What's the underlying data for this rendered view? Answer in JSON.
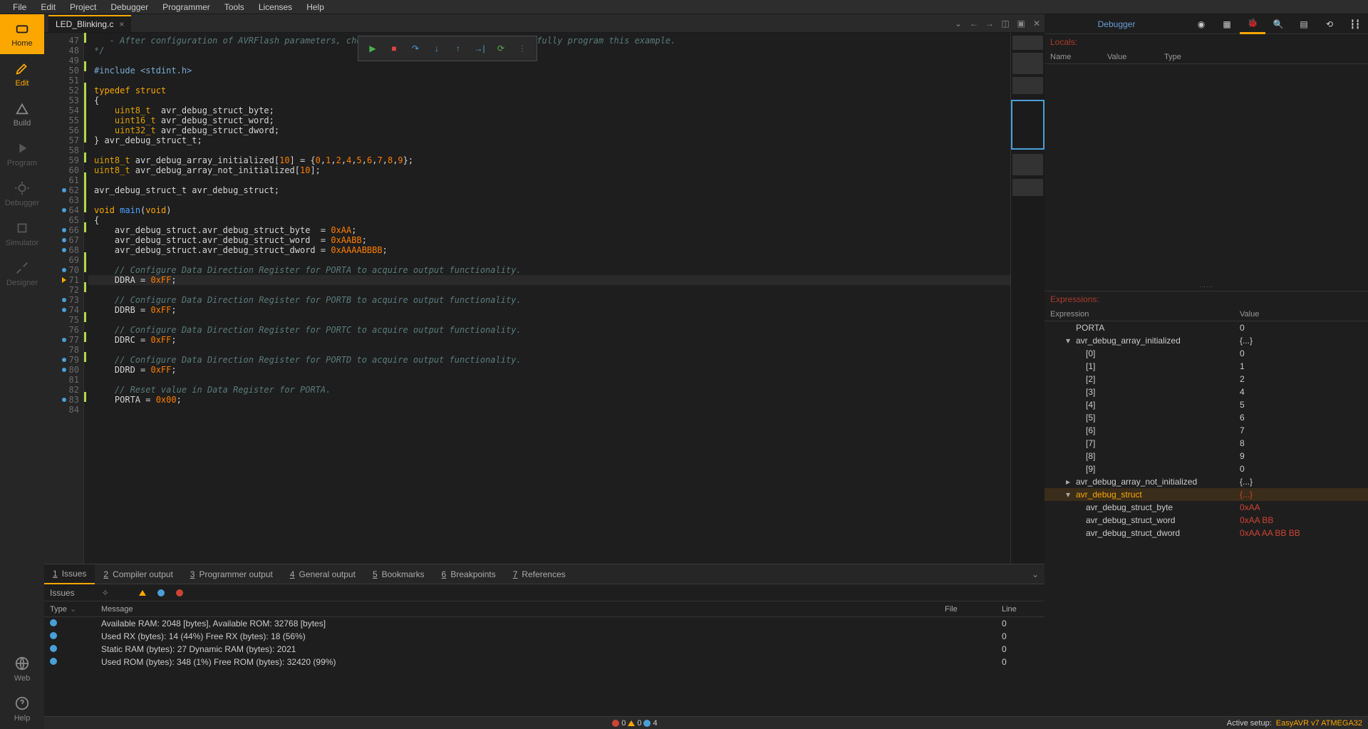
{
  "menu": [
    "File",
    "Edit",
    "Project",
    "Debugger",
    "Programmer",
    "Tools",
    "Licenses",
    "Help"
  ],
  "sidebar": [
    {
      "icon": "home",
      "label": "Home",
      "active": true
    },
    {
      "icon": "edit",
      "label": "Edit",
      "color": "orange"
    },
    {
      "icon": "build",
      "label": "Build"
    },
    {
      "icon": "run",
      "label": "Program",
      "disabled": true
    },
    {
      "icon": "bug",
      "label": "Debugger",
      "disabled": true
    },
    {
      "icon": "chip",
      "label": "Simulator",
      "disabled": true
    },
    {
      "icon": "design",
      "label": "Designer",
      "disabled": true
    }
  ],
  "sidebar_bottom": [
    {
      "icon": "web",
      "label": "Web"
    },
    {
      "icon": "help",
      "label": "Help"
    }
  ],
  "tab": {
    "name": "LED_Blinking.c"
  },
  "debug_tools": [
    "run",
    "stop",
    "step-over",
    "step-into",
    "step-out",
    "run-to",
    "restart",
    "grip"
  ],
  "code_lines": [
    {
      "n": 47,
      "html": "<span class='cmt'>   - After configuration of AVRFlash parameters, choose \"Write\" &nbsp;&nbsp;&nbsp;&nbsp;&nbsp;&nbsp;&nbsp;&nbsp;&nbsp;&nbsp;&nbsp;&nbsp;&nbsp;&nbsp;&nbsp;&nbsp;&nbsp;&nbsp;&nbsp;&nbsp;&nbsp;&nbsp;fully program this example.</span>",
      "mod": true
    },
    {
      "n": 48,
      "html": "<span class='cmt'>*/</span>",
      "mod": true
    },
    {
      "n": 49,
      "html": ""
    },
    {
      "n": 50,
      "html": "<span class='pre'>#include &lt;stdint.h&gt;</span>",
      "mod": true
    },
    {
      "n": 51,
      "html": ""
    },
    {
      "n": 52,
      "html": "<span class='kw'>typedef</span> <span class='kw'>struct</span>",
      "mod": true
    },
    {
      "n": 53,
      "html": "{",
      "mod": true
    },
    {
      "n": 54,
      "html": "    <span class='type'>uint8_t</span>  avr_debug_struct_byte;",
      "mod": true
    },
    {
      "n": 55,
      "html": "    <span class='type'>uint16_t</span> avr_debug_struct_word;",
      "mod": true
    },
    {
      "n": 56,
      "html": "    <span class='type'>uint32_t</span> avr_debug_struct_dword;",
      "mod": true
    },
    {
      "n": 57,
      "html": "} avr_debug_struct_t;",
      "mod": true
    },
    {
      "n": 58,
      "html": ""
    },
    {
      "n": 59,
      "html": "<span class='type'>uint8_t</span> avr_debug_array_initialized[<span class='num'>10</span>] = {<span class='num'>0</span>,<span class='num'>1</span>,<span class='num'>2</span>,<span class='num'>4</span>,<span class='num'>5</span>,<span class='num'>6</span>,<span class='num'>7</span>,<span class='num'>8</span>,<span class='num'>9</span>};",
      "mod": true
    },
    {
      "n": 60,
      "html": "<span class='type'>uint8_t</span> avr_debug_array_not_initialized[<span class='num'>10</span>];",
      "mod": true
    },
    {
      "n": 61,
      "html": ""
    },
    {
      "n": 62,
      "html": "avr_debug_struct_t avr_debug_struct;",
      "mod": true,
      "bp": true
    },
    {
      "n": 63,
      "html": ""
    },
    {
      "n": 64,
      "html": "<span class='kw'>void</span> <span class='func'>main</span>(<span class='kw'>void</span>)",
      "mod": true,
      "bp": true
    },
    {
      "n": 65,
      "html": "{"
    },
    {
      "n": 66,
      "html": "    avr_debug_struct.avr_debug_struct_byte  = <span class='num'>0xAA</span>;",
      "bp": true
    },
    {
      "n": 67,
      "html": "    avr_debug_struct.avr_debug_struct_word  = <span class='num'>0xAABB</span>;",
      "bp": true
    },
    {
      "n": 68,
      "html": "    avr_debug_struct.avr_debug_struct_dword = <span class='num'>0xAAAABBBB</span>;",
      "bp": true
    },
    {
      "n": 69,
      "html": ""
    },
    {
      "n": 70,
      "html": "    <span class='cmt'>// Configure Data Direction Register for PORTA to acquire output functionality.</span>",
      "bp": true
    },
    {
      "n": 71,
      "html": "    DDRA = <span class='num'>0xFF</span>;",
      "current": true,
      "arrow": true
    },
    {
      "n": 72,
      "html": ""
    },
    {
      "n": 73,
      "html": "    <span class='cmt'>// Configure Data Direction Register for PORTB to acquire output functionality.</span>",
      "bp": true
    },
    {
      "n": 74,
      "html": "    DDRB = <span class='num'>0xFF</span>;",
      "bp": true
    },
    {
      "n": 75,
      "html": ""
    },
    {
      "n": 76,
      "html": "    <span class='cmt'>// Configure Data Direction Register for PORTC to acquire output functionality.</span>"
    },
    {
      "n": 77,
      "html": "    DDRC = <span class='num'>0xFF</span>;",
      "bp": true
    },
    {
      "n": 78,
      "html": ""
    },
    {
      "n": 79,
      "html": "    <span class='cmt'>// Configure Data Direction Register for PORTD to acquire output functionality.</span>",
      "bp": true
    },
    {
      "n": 80,
      "html": "    DDRD = <span class='num'>0xFF</span>;",
      "bp": true
    },
    {
      "n": 81,
      "html": ""
    },
    {
      "n": 82,
      "html": "    <span class='cmt'>// Reset value in Data Register for PORTA.</span>"
    },
    {
      "n": 83,
      "html": "    PORTA = <span class='num'>0x00</span>;",
      "bp": true
    },
    {
      "n": 84,
      "html": ""
    }
  ],
  "bottom_tabs": [
    {
      "n": "1",
      "label": "Issues",
      "active": true
    },
    {
      "n": "2",
      "label": "Compiler output"
    },
    {
      "n": "3",
      "label": "Programmer output"
    },
    {
      "n": "4",
      "label": "General output"
    },
    {
      "n": "5",
      "label": "Bookmarks"
    },
    {
      "n": "6",
      "label": "Breakpoints"
    },
    {
      "n": "7",
      "label": "References"
    }
  ],
  "issues_label": "Issues",
  "issues_cols": {
    "type": "Type",
    "message": "Message",
    "file": "File",
    "line": "Line"
  },
  "issues": [
    {
      "msg": "Available RAM: 2048 [bytes], Available ROM: 32768 [bytes]",
      "line": "0"
    },
    {
      "msg": "Used RX (bytes): 14 (44%)   Free RX (bytes): 18 (56%)",
      "line": "0"
    },
    {
      "msg": "Static RAM (bytes): 27   Dynamic RAM (bytes): 2021",
      "line": "0"
    },
    {
      "msg": "Used ROM (bytes): 348 (1%)  Free ROM (bytes): 32420 (99%)",
      "line": "0"
    }
  ],
  "right": {
    "title": "Debugger",
    "locals_title": "Locals:",
    "locals_cols": {
      "name": "Name",
      "value": "Value",
      "type": "Type"
    },
    "expr_title": "Expressions:",
    "expr_cols": {
      "expr": "Expression",
      "value": "Value"
    },
    "expressions": [
      {
        "expr": "PORTA",
        "val": "0",
        "indent": 1
      },
      {
        "expr": "avr_debug_array_initialized",
        "val": "{...}",
        "indent": 1,
        "tree": "▾"
      },
      {
        "expr": "[0]",
        "val": "0",
        "indent": 2
      },
      {
        "expr": "[1]",
        "val": "1",
        "indent": 2
      },
      {
        "expr": "[2]",
        "val": "2",
        "indent": 2
      },
      {
        "expr": "[3]",
        "val": "4",
        "indent": 2
      },
      {
        "expr": "[4]",
        "val": "5",
        "indent": 2
      },
      {
        "expr": "[5]",
        "val": "6",
        "indent": 2
      },
      {
        "expr": "[6]",
        "val": "7",
        "indent": 2
      },
      {
        "expr": "[7]",
        "val": "8",
        "indent": 2
      },
      {
        "expr": "[8]",
        "val": "9",
        "indent": 2
      },
      {
        "expr": "[9]",
        "val": "0",
        "indent": 2
      },
      {
        "expr": "avr_debug_array_not_initialized",
        "val": "{...}",
        "indent": 1,
        "tree": "▸"
      },
      {
        "expr": "avr_debug_struct",
        "val": "{...}",
        "indent": 1,
        "tree": "▾",
        "highlight": true,
        "red": true
      },
      {
        "expr": "avr_debug_struct_byte",
        "val": "0xAA",
        "indent": 2,
        "red": true
      },
      {
        "expr": "avr_debug_struct_word",
        "val": "0xAA BB",
        "indent": 2,
        "red": true
      },
      {
        "expr": "avr_debug_struct_dword",
        "val": "0xAA AA BB BB",
        "indent": 2,
        "red": true
      }
    ]
  },
  "status": {
    "err": "0",
    "warn": "0",
    "info": "4",
    "setup_label": "Active setup:",
    "setup_value": "EasyAVR v7 ATMEGA32"
  }
}
